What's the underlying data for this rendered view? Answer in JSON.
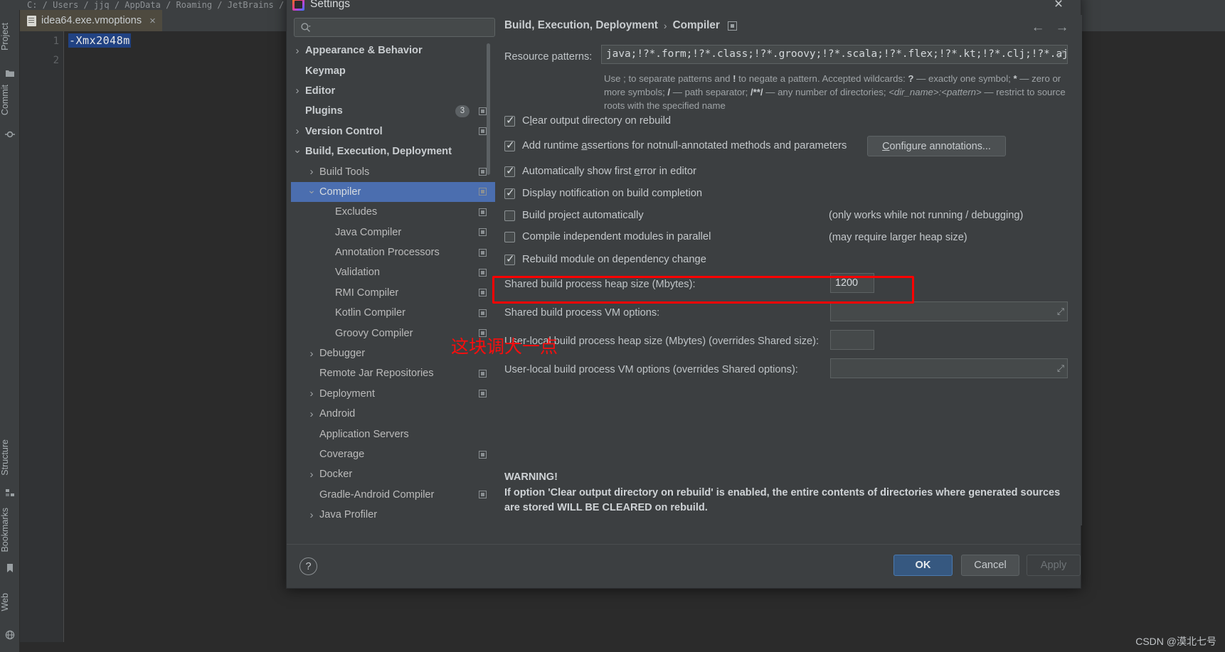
{
  "ide": {
    "breadcrumb": "C: / Users / jjq / AppData / Roaming / JetBrains / Intel",
    "tab": {
      "label": "idea64.exe.vmoptions",
      "close": "×",
      "icon": "file-icon"
    },
    "gutter_lines": [
      "1",
      "2"
    ],
    "code_line": "-Xmx2048m",
    "left_tools": [
      {
        "label": "Project",
        "icon": "folder-icon"
      },
      {
        "label": "Commit",
        "icon": "commit-icon"
      },
      {
        "label": "Structure",
        "icon": "structure-icon"
      },
      {
        "label": "Bookmarks",
        "icon": "bookmark-icon"
      },
      {
        "label": "Web",
        "icon": "web-icon"
      }
    ],
    "watermark": "CSDN @漠北七号"
  },
  "dialog": {
    "title": "Settings",
    "close_icon": "×",
    "search": {
      "value": "",
      "placeholder": ""
    },
    "breadcrumb": {
      "root": "Build, Execution, Deployment",
      "separator": "›",
      "leaf": "Compiler"
    },
    "nav_back": "←",
    "nav_forward": "→",
    "tree": [
      {
        "label": "Appearance & Behavior",
        "level": 0,
        "arrow": "right",
        "bold": true,
        "selected": false,
        "badge": null,
        "mark": false
      },
      {
        "label": "Keymap",
        "level": 0,
        "arrow": null,
        "bold": true,
        "selected": false,
        "badge": null,
        "mark": false
      },
      {
        "label": "Editor",
        "level": 0,
        "arrow": "right",
        "bold": true,
        "selected": false,
        "badge": null,
        "mark": false
      },
      {
        "label": "Plugins",
        "level": 0,
        "arrow": null,
        "bold": true,
        "selected": false,
        "badge": "3",
        "mark": true
      },
      {
        "label": "Version Control",
        "level": 0,
        "arrow": "right",
        "bold": true,
        "selected": false,
        "badge": null,
        "mark": true
      },
      {
        "label": "Build, Execution, Deployment",
        "level": 0,
        "arrow": "down",
        "bold": true,
        "selected": false,
        "badge": null,
        "mark": false
      },
      {
        "label": "Build Tools",
        "level": 1,
        "arrow": "right",
        "bold": false,
        "selected": false,
        "badge": null,
        "mark": true
      },
      {
        "label": "Compiler",
        "level": 1,
        "arrow": "down",
        "bold": false,
        "selected": true,
        "badge": null,
        "mark": true
      },
      {
        "label": "Excludes",
        "level": 2,
        "arrow": null,
        "bold": false,
        "selected": false,
        "badge": null,
        "mark": true
      },
      {
        "label": "Java Compiler",
        "level": 2,
        "arrow": null,
        "bold": false,
        "selected": false,
        "badge": null,
        "mark": true
      },
      {
        "label": "Annotation Processors",
        "level": 2,
        "arrow": null,
        "bold": false,
        "selected": false,
        "badge": null,
        "mark": true
      },
      {
        "label": "Validation",
        "level": 2,
        "arrow": null,
        "bold": false,
        "selected": false,
        "badge": null,
        "mark": true
      },
      {
        "label": "RMI Compiler",
        "level": 2,
        "arrow": null,
        "bold": false,
        "selected": false,
        "badge": null,
        "mark": true
      },
      {
        "label": "Kotlin Compiler",
        "level": 2,
        "arrow": null,
        "bold": false,
        "selected": false,
        "badge": null,
        "mark": true
      },
      {
        "label": "Groovy Compiler",
        "level": 2,
        "arrow": null,
        "bold": false,
        "selected": false,
        "badge": null,
        "mark": true
      },
      {
        "label": "Debugger",
        "level": 1,
        "arrow": "right",
        "bold": false,
        "selected": false,
        "badge": null,
        "mark": false
      },
      {
        "label": "Remote Jar Repositories",
        "level": 1,
        "arrow": null,
        "bold": false,
        "selected": false,
        "badge": null,
        "mark": true
      },
      {
        "label": "Deployment",
        "level": 1,
        "arrow": "right",
        "bold": false,
        "selected": false,
        "badge": null,
        "mark": true
      },
      {
        "label": "Android",
        "level": 1,
        "arrow": "right",
        "bold": false,
        "selected": false,
        "badge": null,
        "mark": false
      },
      {
        "label": "Application Servers",
        "level": 1,
        "arrow": null,
        "bold": false,
        "selected": false,
        "badge": null,
        "mark": false
      },
      {
        "label": "Coverage",
        "level": 1,
        "arrow": null,
        "bold": false,
        "selected": false,
        "badge": null,
        "mark": true
      },
      {
        "label": "Docker",
        "level": 1,
        "arrow": "right",
        "bold": false,
        "selected": false,
        "badge": null,
        "mark": false
      },
      {
        "label": "Gradle-Android Compiler",
        "level": 1,
        "arrow": null,
        "bold": false,
        "selected": false,
        "badge": null,
        "mark": true
      },
      {
        "label": "Java Profiler",
        "level": 1,
        "arrow": "right",
        "bold": false,
        "selected": false,
        "badge": null,
        "mark": false
      }
    ],
    "form": {
      "resource_patterns_label": "Resource patterns:",
      "resource_patterns_value": "java;!?*.form;!?*.class;!?*.groovy;!?*.scala;!?*.flex;!?*.kt;!?*.clj;!?*.aj",
      "hint_line1_a": "Use ; to separate patterns and ",
      "hint_line1_b": "!",
      "hint_line1_c": " to negate a pattern. Accepted wildcards: ",
      "hint_line1_d": "?",
      "hint_line1_e": " — exactly one symbol; ",
      "hint_line1_f": "*",
      "hint_line1_g": " — zero or",
      "hint_line2_a": "more symbols; ",
      "hint_line2_b": "/",
      "hint_line2_c": " — path separator; ",
      "hint_line2_d": "/**/",
      "hint_line2_e": " — any number of directories; ",
      "hint_line2_f": "<dir_name>:<pattern>",
      "hint_line2_g": " — restrict to source",
      "hint_line3": "roots with the specified name",
      "checkboxes": [
        {
          "label_pre": "C",
          "label_underline": "l",
          "label_post": "ear output directory on rebuild",
          "checked": true
        },
        {
          "label_pre": "Add runtime ",
          "label_underline": "a",
          "label_post": "ssertions for notnull-annotated methods and parameters",
          "checked": true
        },
        {
          "label_pre": "Automatically show first ",
          "label_underline": "e",
          "label_post": "rror in editor",
          "checked": true
        },
        {
          "label_pre": "Display notification on build completion",
          "label_underline": "",
          "label_post": "",
          "checked": true
        },
        {
          "label_pre": "Build project automatically",
          "label_underline": "",
          "label_post": "",
          "checked": false
        },
        {
          "label_pre": "Compile independent modules in parallel",
          "label_underline": "",
          "label_post": "",
          "checked": false
        },
        {
          "label_pre": "Rebuild module on dependency change",
          "label_underline": "",
          "label_post": "",
          "checked": true
        }
      ],
      "configure_annotations_btn_pre": "",
      "configure_annotations_btn_u": "C",
      "configure_annotations_btn_post": "onfigure annotations...",
      "note_build_auto": "(only works while not running / debugging)",
      "note_parallel": "(may require larger heap size)",
      "shared_heap_label": "Shared build process heap size (Mbytes):",
      "shared_heap_value": "1200",
      "shared_vm_label": "Shared build process VM options:",
      "shared_vm_value": "",
      "user_heap_label": "User-local build process heap size (Mbytes) (overrides Shared size):",
      "user_heap_value": "",
      "user_vm_label": "User-local build process VM options (overrides Shared options):",
      "user_vm_value": "",
      "expand_icon": "⤢"
    },
    "warning": {
      "title": "WARNING!",
      "line1": "If option 'Clear output directory on rebuild' is enabled, the entire contents of directories where generated sources",
      "line2": "are stored WILL BE CLEARED on rebuild."
    },
    "footer": {
      "help": "?",
      "ok": "OK",
      "cancel": "Cancel",
      "apply": "Apply"
    }
  },
  "annotation": {
    "red_note": "这块调大一点",
    "red_color": "#ff0000"
  }
}
